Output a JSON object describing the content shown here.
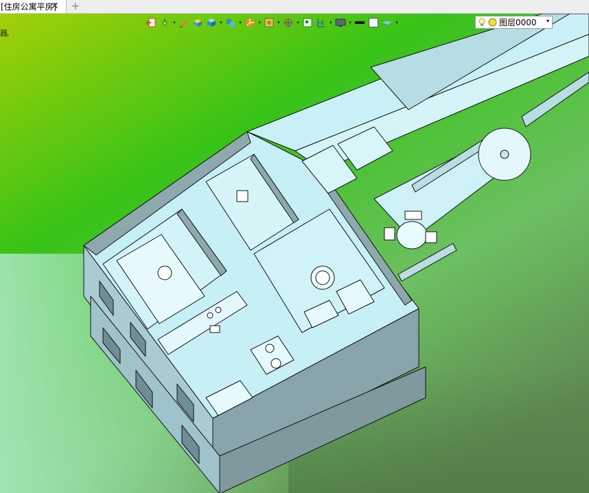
{
  "tab": {
    "title": "[住房公寓平房]",
    "close_label": "✕",
    "add_label": "+"
  },
  "toolbar": {
    "icons": [
      "exit-icon",
      "pen-tool-icon",
      "pencil-icon",
      "layered-box-icon",
      "blue-cube-icon",
      "blue-blocks-icon",
      "orange-pie-icon",
      "roll-icon",
      "crosshair-icon",
      "square-icon",
      "bracket-icon",
      "monitor-icon",
      "black-bar-icon",
      "white-square-icon",
      "layer-stack-icon"
    ],
    "dropdown_glyph": "▾"
  },
  "layer_select": {
    "value": "图层0000",
    "arrow": "▾"
  },
  "side_glyph": "器,",
  "colors": {
    "bg_top": "#9fcc07",
    "bg_mid": "#35c11a",
    "bg_bottom_left": "#a7e5b8",
    "bg_bottom_right": "#5d7f4f",
    "model_light": "#c8f0f6",
    "model_dark": "#8ba7ad"
  }
}
